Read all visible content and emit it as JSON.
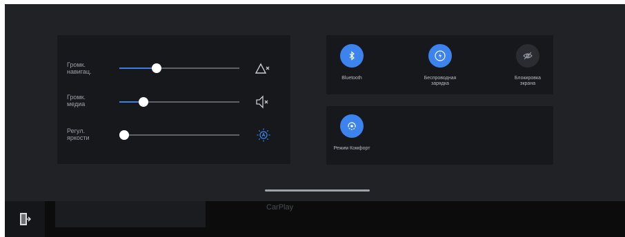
{
  "sliders": [
    {
      "label": "Громк.\nнавигац.",
      "value": 0.31,
      "icon": "navigation-mute-icon"
    },
    {
      "label": "Громк.\nмедиа",
      "value": 0.2,
      "icon": "media-mute-icon"
    },
    {
      "label": "Регул.\nяркости",
      "value": 0.04,
      "icon": "brightness-auto-icon"
    }
  ],
  "toggles": [
    {
      "label": "Bluetooth",
      "icon": "bluetooth-icon",
      "active": true
    },
    {
      "label": "Беспроводная\nзарядка",
      "icon": "wireless-charging-icon",
      "active": true
    },
    {
      "label": "Блокировка\nэкрана",
      "icon": "eye-off-icon",
      "active": false
    }
  ],
  "comfort": {
    "label": "Режим Комфорт",
    "icon": "comfort-mode-icon",
    "active": true
  },
  "dock": {
    "carplay_label": "CarPlay",
    "exit_icon": "exit-door-icon"
  },
  "colors": {
    "accent": "#3d83ee",
    "panel": "#202226",
    "card": "#17181b",
    "track": "#5f6368"
  }
}
